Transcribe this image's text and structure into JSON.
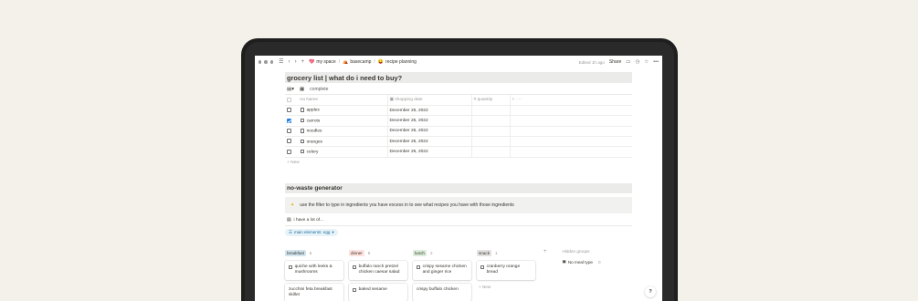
{
  "topbar": {
    "breadcrumb": [
      {
        "emoji": "💖",
        "label": "my space"
      },
      {
        "emoji": "⛺",
        "label": "basecamp"
      },
      {
        "emoji": "😛",
        "label": "recipe planning"
      }
    ],
    "edited": "Edited 1h ago",
    "share": "Share"
  },
  "grocery": {
    "title": "grocery list | what do i need to buy?",
    "view_label": "complete",
    "columns": {
      "name": "Aa Name",
      "date": "shopping date",
      "quantity": "quantity"
    },
    "rows": [
      {
        "name": "apples",
        "date": "December 25, 2022",
        "checked": false
      },
      {
        "name": "carrots",
        "date": "December 25, 2022",
        "checked": true
      },
      {
        "name": "noodles",
        "date": "December 25, 2022",
        "checked": false
      },
      {
        "name": "oranges",
        "date": "December 25, 2022",
        "checked": false
      },
      {
        "name": "celery",
        "date": "December 25, 2022",
        "checked": false
      }
    ],
    "new_label": "+ New"
  },
  "generator": {
    "title": "no-waste generator",
    "callout": "use the filter to type in ingredients you have excess in to see what recipes you have with those ingredients",
    "view_label": "i have a lot of...",
    "filter_label": "main elements: egg",
    "columns": [
      {
        "name": "breakfast",
        "count": "6",
        "color": "#d3e5ef",
        "cards": [
          "quiche with leeks & mushrooms",
          "zucchini feta breakfast skillet"
        ]
      },
      {
        "name": "dinner",
        "count": "5",
        "color": "#ffe2dd",
        "cards": [
          "buffalo ranch pretzel chicken caesar salad",
          "baked sesame"
        ]
      },
      {
        "name": "lunch",
        "count": "2",
        "color": "#dbeddb",
        "cards": [
          "crispy sesame chicken and ginger rice",
          "crispy buffalo chicken"
        ]
      },
      {
        "name": "snack",
        "count": "1",
        "color": "#e3e2e0",
        "cards": [
          "cranberry orange bread"
        ]
      }
    ],
    "new_label": "+ New",
    "hidden_groups_label": "Hidden groups",
    "hidden_group": {
      "name": "No meal type",
      "count": "0"
    }
  },
  "help": "?"
}
